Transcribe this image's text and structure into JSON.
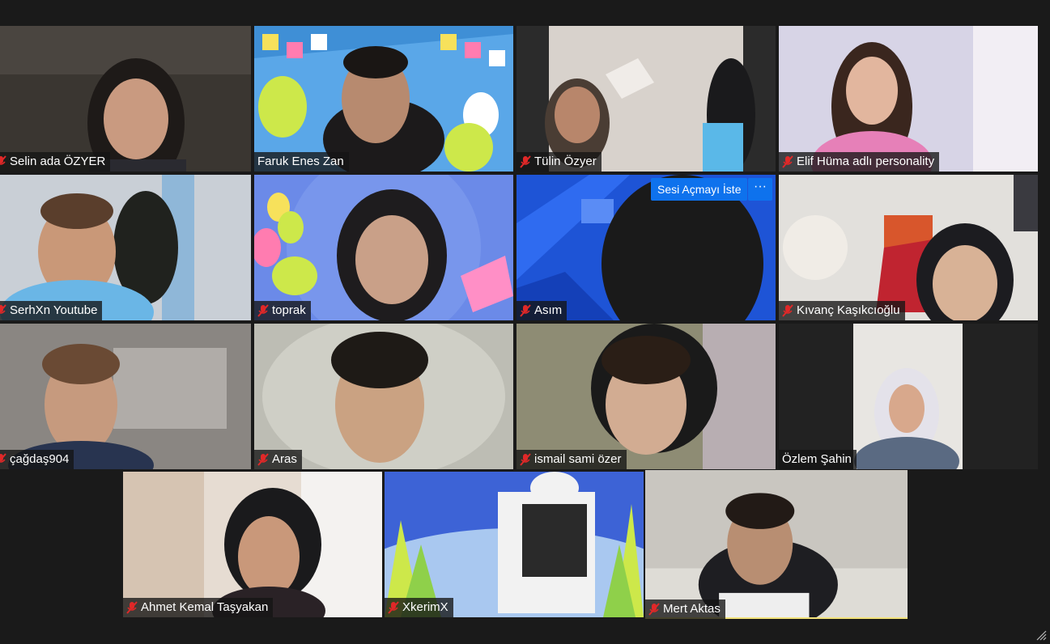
{
  "participants": [
    {
      "name": "Selin ada ÖZYER",
      "muted": true
    },
    {
      "name": "Faruk Enes Zan",
      "muted": false
    },
    {
      "name": "Tülin Özyer",
      "muted": true
    },
    {
      "name": "Elif Hüma adlı personality",
      "muted": true
    },
    {
      "name": "SerhXn Youtube",
      "muted": true
    },
    {
      "name": "toprak",
      "muted": true
    },
    {
      "name": "Asım",
      "muted": true
    },
    {
      "name": "Kıvanç Kaşıkcıoğlu",
      "muted": true
    },
    {
      "name": "çağdaş904",
      "muted": true
    },
    {
      "name": "Aras",
      "muted": true
    },
    {
      "name": "ismail sami özer",
      "muted": true
    },
    {
      "name": "Özlem Şahin",
      "muted": false
    },
    {
      "name": "Ahmet Kemal Taşyakan",
      "muted": true
    },
    {
      "name": "XkerimX",
      "muted": true
    },
    {
      "name": "Mert Aktas",
      "muted": true,
      "active_speaker": true
    }
  ],
  "overlay": {
    "ask_unmute_label": "Sesi Açmayı İste",
    "more_label": "···"
  },
  "colors": {
    "background": "#1a1a1a",
    "accent_blue": "#0e72ed",
    "muted_red": "#e02828",
    "active_speaker_border": "#f2e27a"
  }
}
